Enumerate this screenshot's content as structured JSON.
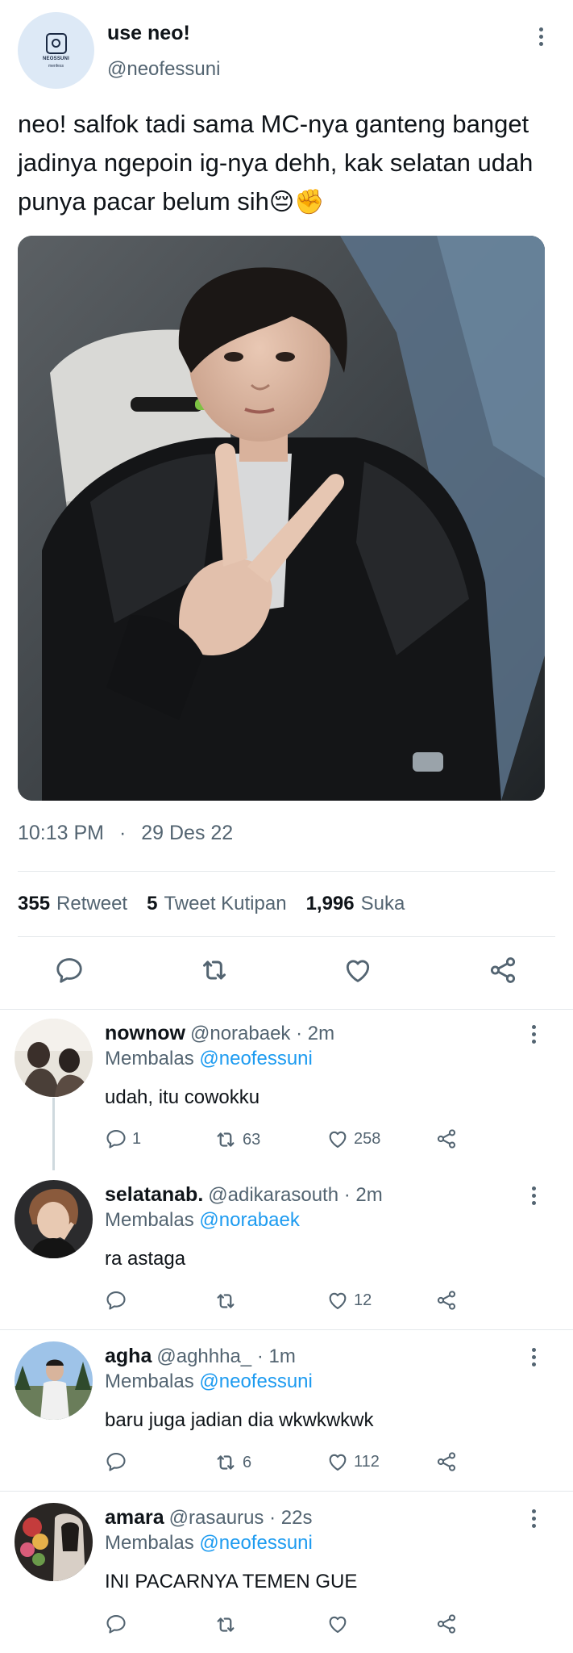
{
  "main_tweet": {
    "avatar_logo_text": "NEOSSUNI",
    "avatar_logo_sub": "menfess",
    "display_name": "use neo!",
    "handle": "@neofessuni",
    "text": "neo! salfok tadi sama MC-nya ganteng banget jadinya ngepoin ig-nya dehh, kak selatan udah punya pacar belum sih",
    "emojis": "😔✊",
    "time": "10:13 PM",
    "separator": "·",
    "date": "29 Des 22",
    "stats": {
      "retweets": {
        "count": "355",
        "label": "Retweet"
      },
      "quotes": {
        "count": "5",
        "label": "Tweet Kutipan"
      },
      "likes": {
        "count": "1,996",
        "label": "Suka"
      }
    }
  },
  "replies": [
    {
      "name": "nownow",
      "handle": "@norabaek",
      "time": "· 2m",
      "replying_label": "Membalas",
      "replying_to": "@neofessuni",
      "text": "udah, itu cowokku",
      "replies": "1",
      "retweets": "63",
      "likes": "258"
    },
    {
      "name": "selatanab.",
      "handle": "@adikarasouth",
      "time": "· 2m",
      "replying_label": "Membalas",
      "replying_to": "@norabaek",
      "text": "ra astaga",
      "replies": "",
      "retweets": "",
      "likes": "12"
    },
    {
      "name": "agha",
      "handle": "@aghhha_",
      "time": "· 1m",
      "replying_label": "Membalas",
      "replying_to": "@neofessuni",
      "text": "baru juga jadian dia wkwkwkwk",
      "replies": "",
      "retweets": "6",
      "likes": "112"
    },
    {
      "name": "amara",
      "handle": "@rasaurus",
      "time": "· 22s",
      "replying_label": "Membalas",
      "replying_to": "@neofessuni",
      "text": "INI PACARNYA TEMEN GUE",
      "replies": "",
      "retweets": "",
      "likes": ""
    }
  ],
  "icons": {
    "reply": "reply-icon",
    "retweet": "retweet-icon",
    "like": "heart-icon",
    "share": "share-icon",
    "more": "more-icon"
  },
  "colors": {
    "link": "#1d9bf0",
    "muted": "#536471",
    "text": "#0f1419",
    "divider": "#e4e8eb"
  }
}
